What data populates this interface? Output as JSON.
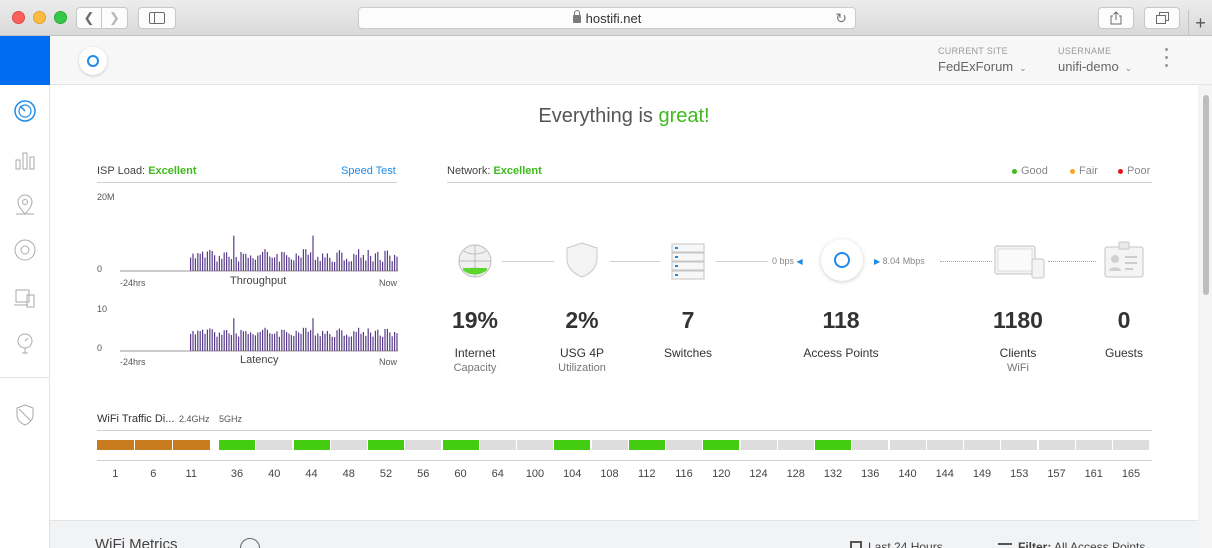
{
  "browser": {
    "url": "hostifi.net"
  },
  "header": {
    "site_label": "CURRENT SITE",
    "site_value": "FedExForum",
    "user_label": "USERNAME",
    "user_value": "unifi-demo"
  },
  "headline": {
    "prefix": "Everything is",
    "status": "great!"
  },
  "isp": {
    "label": "ISP Load:",
    "status": "Excellent",
    "speed_test": "Speed Test",
    "throughput": {
      "title": "Throughput",
      "y_max": "20M",
      "y_min": "0",
      "x_start": "-24hrs",
      "x_end": "Now"
    },
    "latency": {
      "title": "Latency",
      "y_max": "10",
      "y_min": "0",
      "x_start": "-24hrs",
      "x_end": "Now"
    }
  },
  "network": {
    "label": "Network:",
    "status": "Excellent",
    "legend": [
      {
        "label": "Good",
        "color": "#3dbb1b"
      },
      {
        "label": "Fair",
        "color": "#f5a623"
      },
      {
        "label": "Poor",
        "color": "#e0141e"
      }
    ],
    "uplink_rate": "0 bps",
    "downlink_rate": "8.04 Mbps",
    "stats": [
      {
        "value": "19%",
        "label": "Internet",
        "sub": "Capacity"
      },
      {
        "value": "2%",
        "label": "USG 4P",
        "sub": "Utilization"
      },
      {
        "value": "7",
        "label": "Switches",
        "sub": ""
      },
      {
        "value": "118",
        "label": "Access Points",
        "sub": ""
      },
      {
        "value": "1180",
        "label": "Clients",
        "sub": "WiFi"
      },
      {
        "value": "0",
        "label": "Guests",
        "sub": ""
      }
    ]
  },
  "wifi_traffic": {
    "title": "WiFi Traffic Di...",
    "band_24": "2.4GHz",
    "band_5": "5GHz",
    "channels_24": [
      "1",
      "6",
      "11"
    ],
    "channels_5": [
      "36",
      "40",
      "44",
      "48",
      "52",
      "56",
      "60",
      "64",
      "100",
      "104",
      "108",
      "112",
      "116",
      "120",
      "124",
      "128",
      "132",
      "136",
      "140",
      "144",
      "149",
      "153",
      "157",
      "161",
      "165"
    ],
    "active_5": [
      "36",
      "44",
      "52",
      "60",
      "104",
      "112",
      "120",
      "132"
    ],
    "colors": {
      "band24": "#c87c1e",
      "active": "#44cc11",
      "idle": "#dddddd"
    }
  },
  "footer": {
    "metrics_title": "WiFi Metrics",
    "time_range": "Last 24 Hours",
    "filter_label": "Filter:",
    "filter_value": "All Access Points"
  }
}
